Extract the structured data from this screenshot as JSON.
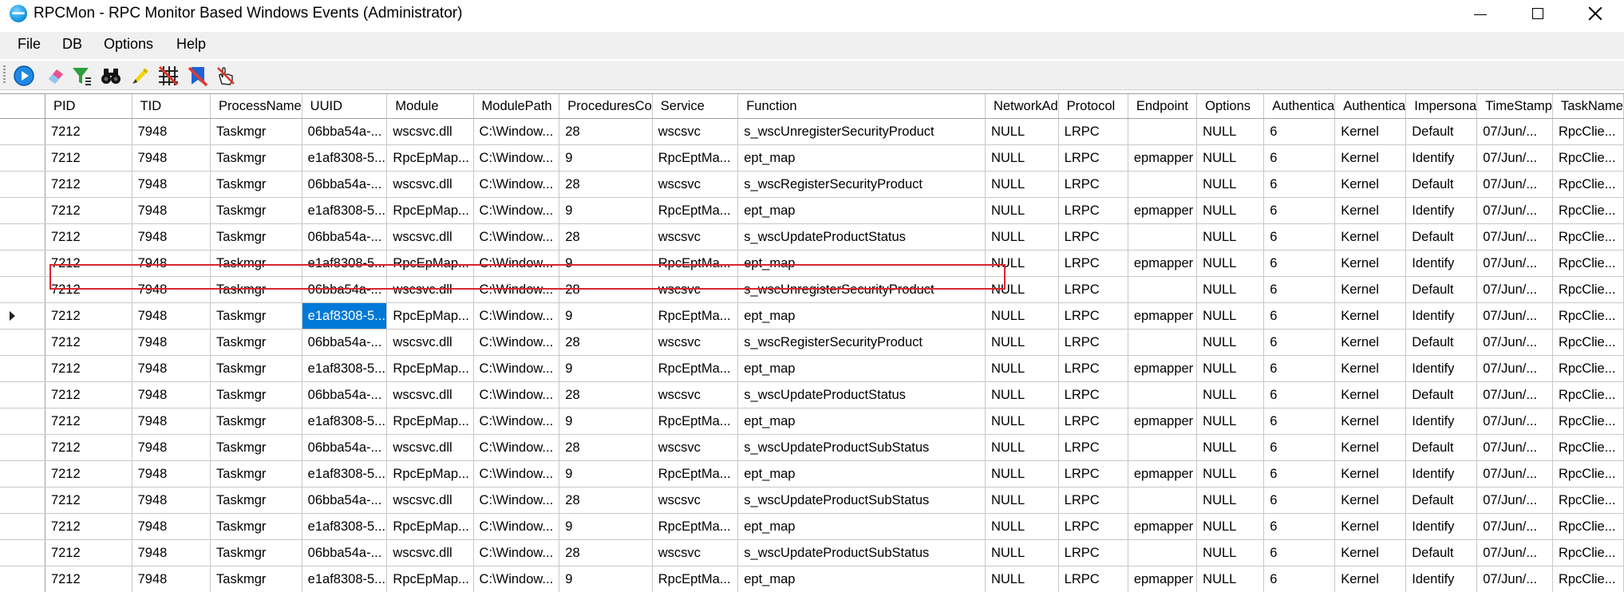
{
  "window": {
    "title": "RPCMon - RPC Monitor Based Windows Events (Administrator)",
    "app_icon": "globe-icon",
    "controls": [
      "minimize-icon",
      "maximize-icon",
      "close-icon"
    ]
  },
  "menu": [
    "File",
    "DB",
    "Options",
    "Help"
  ],
  "toolbar": {
    "tools": [
      "play-icon",
      "eraser-icon",
      "filter-icon",
      "binoculars-icon",
      "highlight-pen-icon",
      "grid-icon",
      "bookmark-clear-icon",
      "hand-pointer-icon"
    ]
  },
  "colors": {
    "selection": "#0078d7",
    "highlight_border": "#d9262c"
  },
  "grid": {
    "columns": [
      "PID",
      "TID",
      "ProcessName",
      "UUID",
      "Module",
      "ModulePath",
      "ProceduresCo",
      "Service",
      "Function",
      "NetworkAd",
      "Protocol",
      "Endpoint",
      "Options",
      "Authentica",
      "Authentica",
      "Impersona",
      "TimeStamp",
      "TaskName"
    ],
    "current_row_index": 7,
    "selected_cell": {
      "row": 7,
      "column": "UUID"
    },
    "highlighted_row_index": 2,
    "rows": [
      [
        "7212",
        "7948",
        "Taskmgr",
        "06bba54a-...",
        "wscsvc.dll",
        "C:\\Window...",
        "28",
        "wscsvc",
        "s_wscUnregisterSecurityProduct",
        "NULL",
        "LRPC",
        "",
        "NULL",
        "6",
        "Kernel",
        "Default",
        "07/Jun/...",
        "RpcClie..."
      ],
      [
        "7212",
        "7948",
        "Taskmgr",
        "e1af8308-5...",
        "RpcEpMap...",
        "C:\\Window...",
        "9",
        "RpcEptMa...",
        "ept_map",
        "NULL",
        "LRPC",
        "epmapper",
        "NULL",
        "6",
        "Kernel",
        "Identify",
        "07/Jun/...",
        "RpcClie..."
      ],
      [
        "7212",
        "7948",
        "Taskmgr",
        "06bba54a-...",
        "wscsvc.dll",
        "C:\\Window...",
        "28",
        "wscsvc",
        "s_wscRegisterSecurityProduct",
        "NULL",
        "LRPC",
        "",
        "NULL",
        "6",
        "Kernel",
        "Default",
        "07/Jun/...",
        "RpcClie..."
      ],
      [
        "7212",
        "7948",
        "Taskmgr",
        "e1af8308-5...",
        "RpcEpMap...",
        "C:\\Window...",
        "9",
        "RpcEptMa...",
        "ept_map",
        "NULL",
        "LRPC",
        "epmapper",
        "NULL",
        "6",
        "Kernel",
        "Identify",
        "07/Jun/...",
        "RpcClie..."
      ],
      [
        "7212",
        "7948",
        "Taskmgr",
        "06bba54a-...",
        "wscsvc.dll",
        "C:\\Window...",
        "28",
        "wscsvc",
        "s_wscUpdateProductStatus",
        "NULL",
        "LRPC",
        "",
        "NULL",
        "6",
        "Kernel",
        "Default",
        "07/Jun/...",
        "RpcClie..."
      ],
      [
        "7212",
        "7948",
        "Taskmgr",
        "e1af8308-5...",
        "RpcEpMap...",
        "C:\\Window...",
        "9",
        "RpcEptMa...",
        "ept_map",
        "NULL",
        "LRPC",
        "epmapper",
        "NULL",
        "6",
        "Kernel",
        "Identify",
        "07/Jun/...",
        "RpcClie..."
      ],
      [
        "7212",
        "7948",
        "Taskmgr",
        "06bba54a-...",
        "wscsvc.dll",
        "C:\\Window...",
        "28",
        "wscsvc",
        "s_wscUnregisterSecurityProduct",
        "NULL",
        "LRPC",
        "",
        "NULL",
        "6",
        "Kernel",
        "Default",
        "07/Jun/...",
        "RpcClie..."
      ],
      [
        "7212",
        "7948",
        "Taskmgr",
        "e1af8308-5...",
        "RpcEpMap...",
        "C:\\Window...",
        "9",
        "RpcEptMa...",
        "ept_map",
        "NULL",
        "LRPC",
        "epmapper",
        "NULL",
        "6",
        "Kernel",
        "Identify",
        "07/Jun/...",
        "RpcClie..."
      ],
      [
        "7212",
        "7948",
        "Taskmgr",
        "06bba54a-...",
        "wscsvc.dll",
        "C:\\Window...",
        "28",
        "wscsvc",
        "s_wscRegisterSecurityProduct",
        "NULL",
        "LRPC",
        "",
        "NULL",
        "6",
        "Kernel",
        "Default",
        "07/Jun/...",
        "RpcClie..."
      ],
      [
        "7212",
        "7948",
        "Taskmgr",
        "e1af8308-5...",
        "RpcEpMap...",
        "C:\\Window...",
        "9",
        "RpcEptMa...",
        "ept_map",
        "NULL",
        "LRPC",
        "epmapper",
        "NULL",
        "6",
        "Kernel",
        "Identify",
        "07/Jun/...",
        "RpcClie..."
      ],
      [
        "7212",
        "7948",
        "Taskmgr",
        "06bba54a-...",
        "wscsvc.dll",
        "C:\\Window...",
        "28",
        "wscsvc",
        "s_wscUpdateProductStatus",
        "NULL",
        "LRPC",
        "",
        "NULL",
        "6",
        "Kernel",
        "Default",
        "07/Jun/...",
        "RpcClie..."
      ],
      [
        "7212",
        "7948",
        "Taskmgr",
        "e1af8308-5...",
        "RpcEpMap...",
        "C:\\Window...",
        "9",
        "RpcEptMa...",
        "ept_map",
        "NULL",
        "LRPC",
        "epmapper",
        "NULL",
        "6",
        "Kernel",
        "Identify",
        "07/Jun/...",
        "RpcClie..."
      ],
      [
        "7212",
        "7948",
        "Taskmgr",
        "06bba54a-...",
        "wscsvc.dll",
        "C:\\Window...",
        "28",
        "wscsvc",
        "s_wscUpdateProductSubStatus",
        "NULL",
        "LRPC",
        "",
        "NULL",
        "6",
        "Kernel",
        "Default",
        "07/Jun/...",
        "RpcClie..."
      ],
      [
        "7212",
        "7948",
        "Taskmgr",
        "e1af8308-5...",
        "RpcEpMap...",
        "C:\\Window...",
        "9",
        "RpcEptMa...",
        "ept_map",
        "NULL",
        "LRPC",
        "epmapper",
        "NULL",
        "6",
        "Kernel",
        "Identify",
        "07/Jun/...",
        "RpcClie..."
      ],
      [
        "7212",
        "7948",
        "Taskmgr",
        "06bba54a-...",
        "wscsvc.dll",
        "C:\\Window...",
        "28",
        "wscsvc",
        "s_wscUpdateProductSubStatus",
        "NULL",
        "LRPC",
        "",
        "NULL",
        "6",
        "Kernel",
        "Default",
        "07/Jun/...",
        "RpcClie..."
      ],
      [
        "7212",
        "7948",
        "Taskmgr",
        "e1af8308-5...",
        "RpcEpMap...",
        "C:\\Window...",
        "9",
        "RpcEptMa...",
        "ept_map",
        "NULL",
        "LRPC",
        "epmapper",
        "NULL",
        "6",
        "Kernel",
        "Identify",
        "07/Jun/...",
        "RpcClie..."
      ],
      [
        "7212",
        "7948",
        "Taskmgr",
        "06bba54a-...",
        "wscsvc.dll",
        "C:\\Window...",
        "28",
        "wscsvc",
        "s_wscUpdateProductSubStatus",
        "NULL",
        "LRPC",
        "",
        "NULL",
        "6",
        "Kernel",
        "Default",
        "07/Jun/...",
        "RpcClie..."
      ],
      [
        "7212",
        "7948",
        "Taskmgr",
        "e1af8308-5...",
        "RpcEpMap...",
        "C:\\Window...",
        "9",
        "RpcEptMa...",
        "ept_map",
        "NULL",
        "LRPC",
        "epmapper",
        "NULL",
        "6",
        "Kernel",
        "Identify",
        "07/Jun/...",
        "RpcClie..."
      ]
    ]
  }
}
